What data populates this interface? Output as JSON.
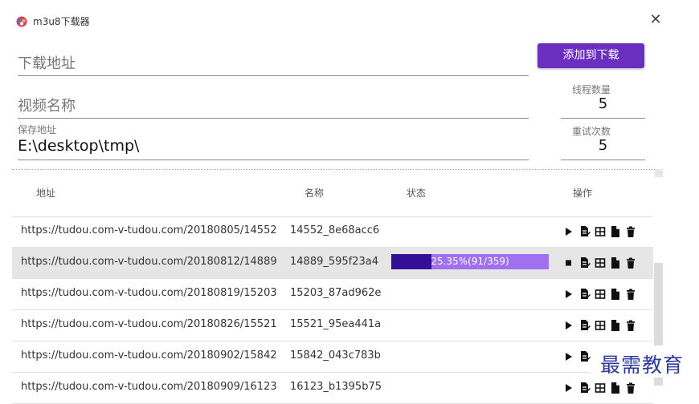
{
  "window": {
    "title": "m3u8下载器",
    "close_glyph": "✕",
    "icon": "app-icon"
  },
  "form": {
    "url_placeholder": "下载地址",
    "name_placeholder": "视频名称",
    "save_label": "保存地址",
    "save_value": "E:\\desktop\\tmp\\",
    "add_button": "添加到下载",
    "threads_label": "线程数量",
    "threads_value": "5",
    "retries_label": "重试次数",
    "retries_value": "5"
  },
  "table": {
    "columns": [
      "地址",
      "名称",
      "状态",
      "操作"
    ],
    "rows": [
      {
        "url": "https://tudou.com-v-tudou.com/20180805/14552",
        "name": "14552_8e68acc6",
        "status": ""
      },
      {
        "url": "https://tudou.com-v-tudou.com/20180812/14889",
        "name": "14889_595f23a4",
        "status": "25.35%(91/359)",
        "progress": 0.2535,
        "selected": true
      },
      {
        "url": "https://tudou.com-v-tudou.com/20180819/15203",
        "name": "15203_87ad962e",
        "status": ""
      },
      {
        "url": "https://tudou.com-v-tudou.com/20180826/15521",
        "name": "15521_95ea441a",
        "status": ""
      },
      {
        "url": "https://tudou.com-v-tudou.com/20180902/15842",
        "name": "15842_043c783b",
        "status": ""
      },
      {
        "url": "https://tudou.com-v-tudou.com/20180909/16123",
        "name": "16123_b1395b75",
        "status": ""
      }
    ]
  },
  "colors": {
    "accent": "#6a2fbf",
    "progress_fill": "#320f96",
    "progress_track": "#a070f0",
    "watermark": "#2d3a9c"
  },
  "watermark": "最需教育"
}
